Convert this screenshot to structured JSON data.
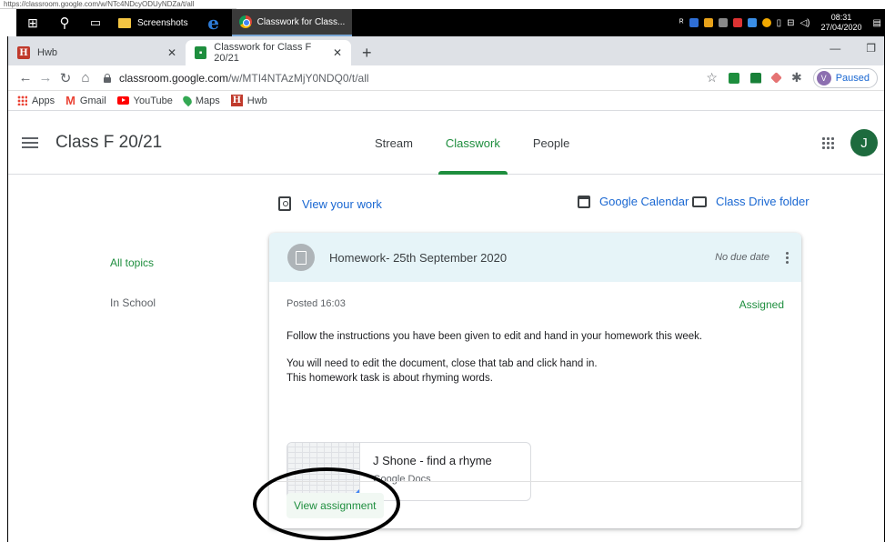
{
  "top_url": "https://classroom.google.com/w/NTc4NDcyODUyNDZa/t/all",
  "taskbar": {
    "items": [
      "Screenshots",
      "Classwork for Class..."
    ],
    "clock_time": "08:31",
    "clock_date": "27/04/2020"
  },
  "browser": {
    "tabs": [
      {
        "title": "Hwb",
        "favicon": "H"
      },
      {
        "title": "Classwork for Class F 20/21"
      }
    ],
    "url_host": "classroom.google.com",
    "url_path": "/w/MTI4NTAzMjY0NDQ0/t/all",
    "profile_initial": "V",
    "profile_status": "Paused",
    "bookmarks": [
      "Apps",
      "Gmail",
      "YouTube",
      "Maps",
      "Hwb"
    ]
  },
  "classroom": {
    "class_name": "Class F 20/21",
    "nav_tabs": [
      "Stream",
      "Classwork",
      "People"
    ],
    "user_initial": "J",
    "actions": {
      "view_work": "View your work",
      "calendar": "Google Calendar",
      "drive": "Class Drive folder"
    },
    "topics": [
      "All topics",
      "In School"
    ],
    "assignment": {
      "title": "Homework- 25th September 2020",
      "due": "No due date",
      "posted": "Posted 16:03",
      "status": "Assigned",
      "instructions": [
        "Follow the instructions you have been given to edit and hand in your homework this week.",
        "You will need to edit the document, close that tab and click hand in.",
        "This homework task is about rhyming words."
      ],
      "attachment_title": "J Shone - find a rhyme",
      "attachment_type": "Google Docs",
      "view_button": "View assignment"
    }
  },
  "colors": {
    "accent_green": "#1e8e3e",
    "link_blue": "#1967d2",
    "card_header": "#e6f4f8"
  }
}
